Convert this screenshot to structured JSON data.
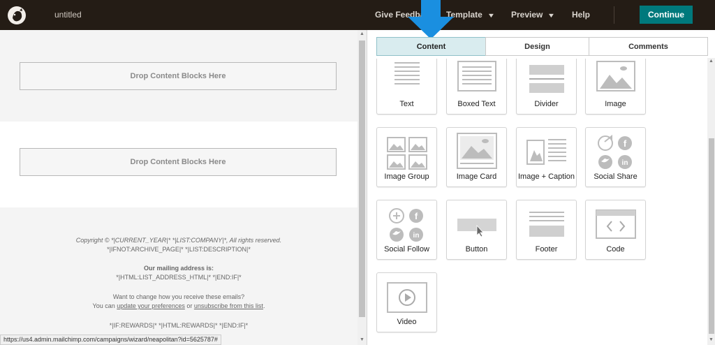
{
  "header": {
    "doc_title": "untitled",
    "nav": {
      "give_feedback": "Give Feedback",
      "template": "Template",
      "preview": "Preview",
      "help": "Help"
    },
    "continue_label": "Continue"
  },
  "canvas": {
    "drop_label_1": "Drop Content Blocks Here",
    "drop_label_2": "Drop Content Blocks Here",
    "footer": {
      "copyright": "Copyright © *|CURRENT_YEAR|* *|LIST:COMPANY|*, All rights reserved.",
      "archive": "*|IFNOT:ARCHIVE_PAGE|* *|LIST:DESCRIPTION|*",
      "mailing_heading": "Our mailing address is:",
      "mailing_value": "*|HTML:LIST_ADDRESS_HTML|* *|END:IF|*",
      "change_q": "Want to change how you receive these emails?",
      "you_can": "You can",
      "update_link": "update your preferences",
      "or": "or",
      "unsub_link": "unsubscribe from this list",
      "rewards": "*|IF:REWARDS|* *|HTML:REWARDS|* *|END:IF|*"
    }
  },
  "status_url": "https://us4.admin.mailchimp.com/campaigns/wizard/neapolitan?id=5625787#",
  "tabs": [
    {
      "label": "Content",
      "active": true
    },
    {
      "label": "Design",
      "active": false
    },
    {
      "label": "Comments",
      "active": false
    }
  ],
  "blocks": [
    {
      "label": "Text",
      "icon": "text-block-icon"
    },
    {
      "label": "Boxed Text",
      "icon": "boxed-text-block-icon"
    },
    {
      "label": "Divider",
      "icon": "divider-block-icon"
    },
    {
      "label": "Image",
      "icon": "image-block-icon"
    },
    {
      "label": "Image Group",
      "icon": "image-group-block-icon"
    },
    {
      "label": "Image Card",
      "icon": "image-card-block-icon"
    },
    {
      "label": "Image + Caption",
      "icon": "image-caption-block-icon"
    },
    {
      "label": "Social Share",
      "icon": "social-share-block-icon"
    },
    {
      "label": "Social Follow",
      "icon": "social-follow-block-icon"
    },
    {
      "label": "Button",
      "icon": "button-block-icon"
    },
    {
      "label": "Footer",
      "icon": "footer-block-icon"
    },
    {
      "label": "Code",
      "icon": "code-block-icon"
    },
    {
      "label": "Video",
      "icon": "video-block-icon"
    }
  ],
  "colors": {
    "topbar": "#241c15",
    "continue": "#00797c",
    "active_tab": "#d9ecef",
    "callout_arrow": "#1a8fe0",
    "icon_gray": "#bcbcbc"
  }
}
